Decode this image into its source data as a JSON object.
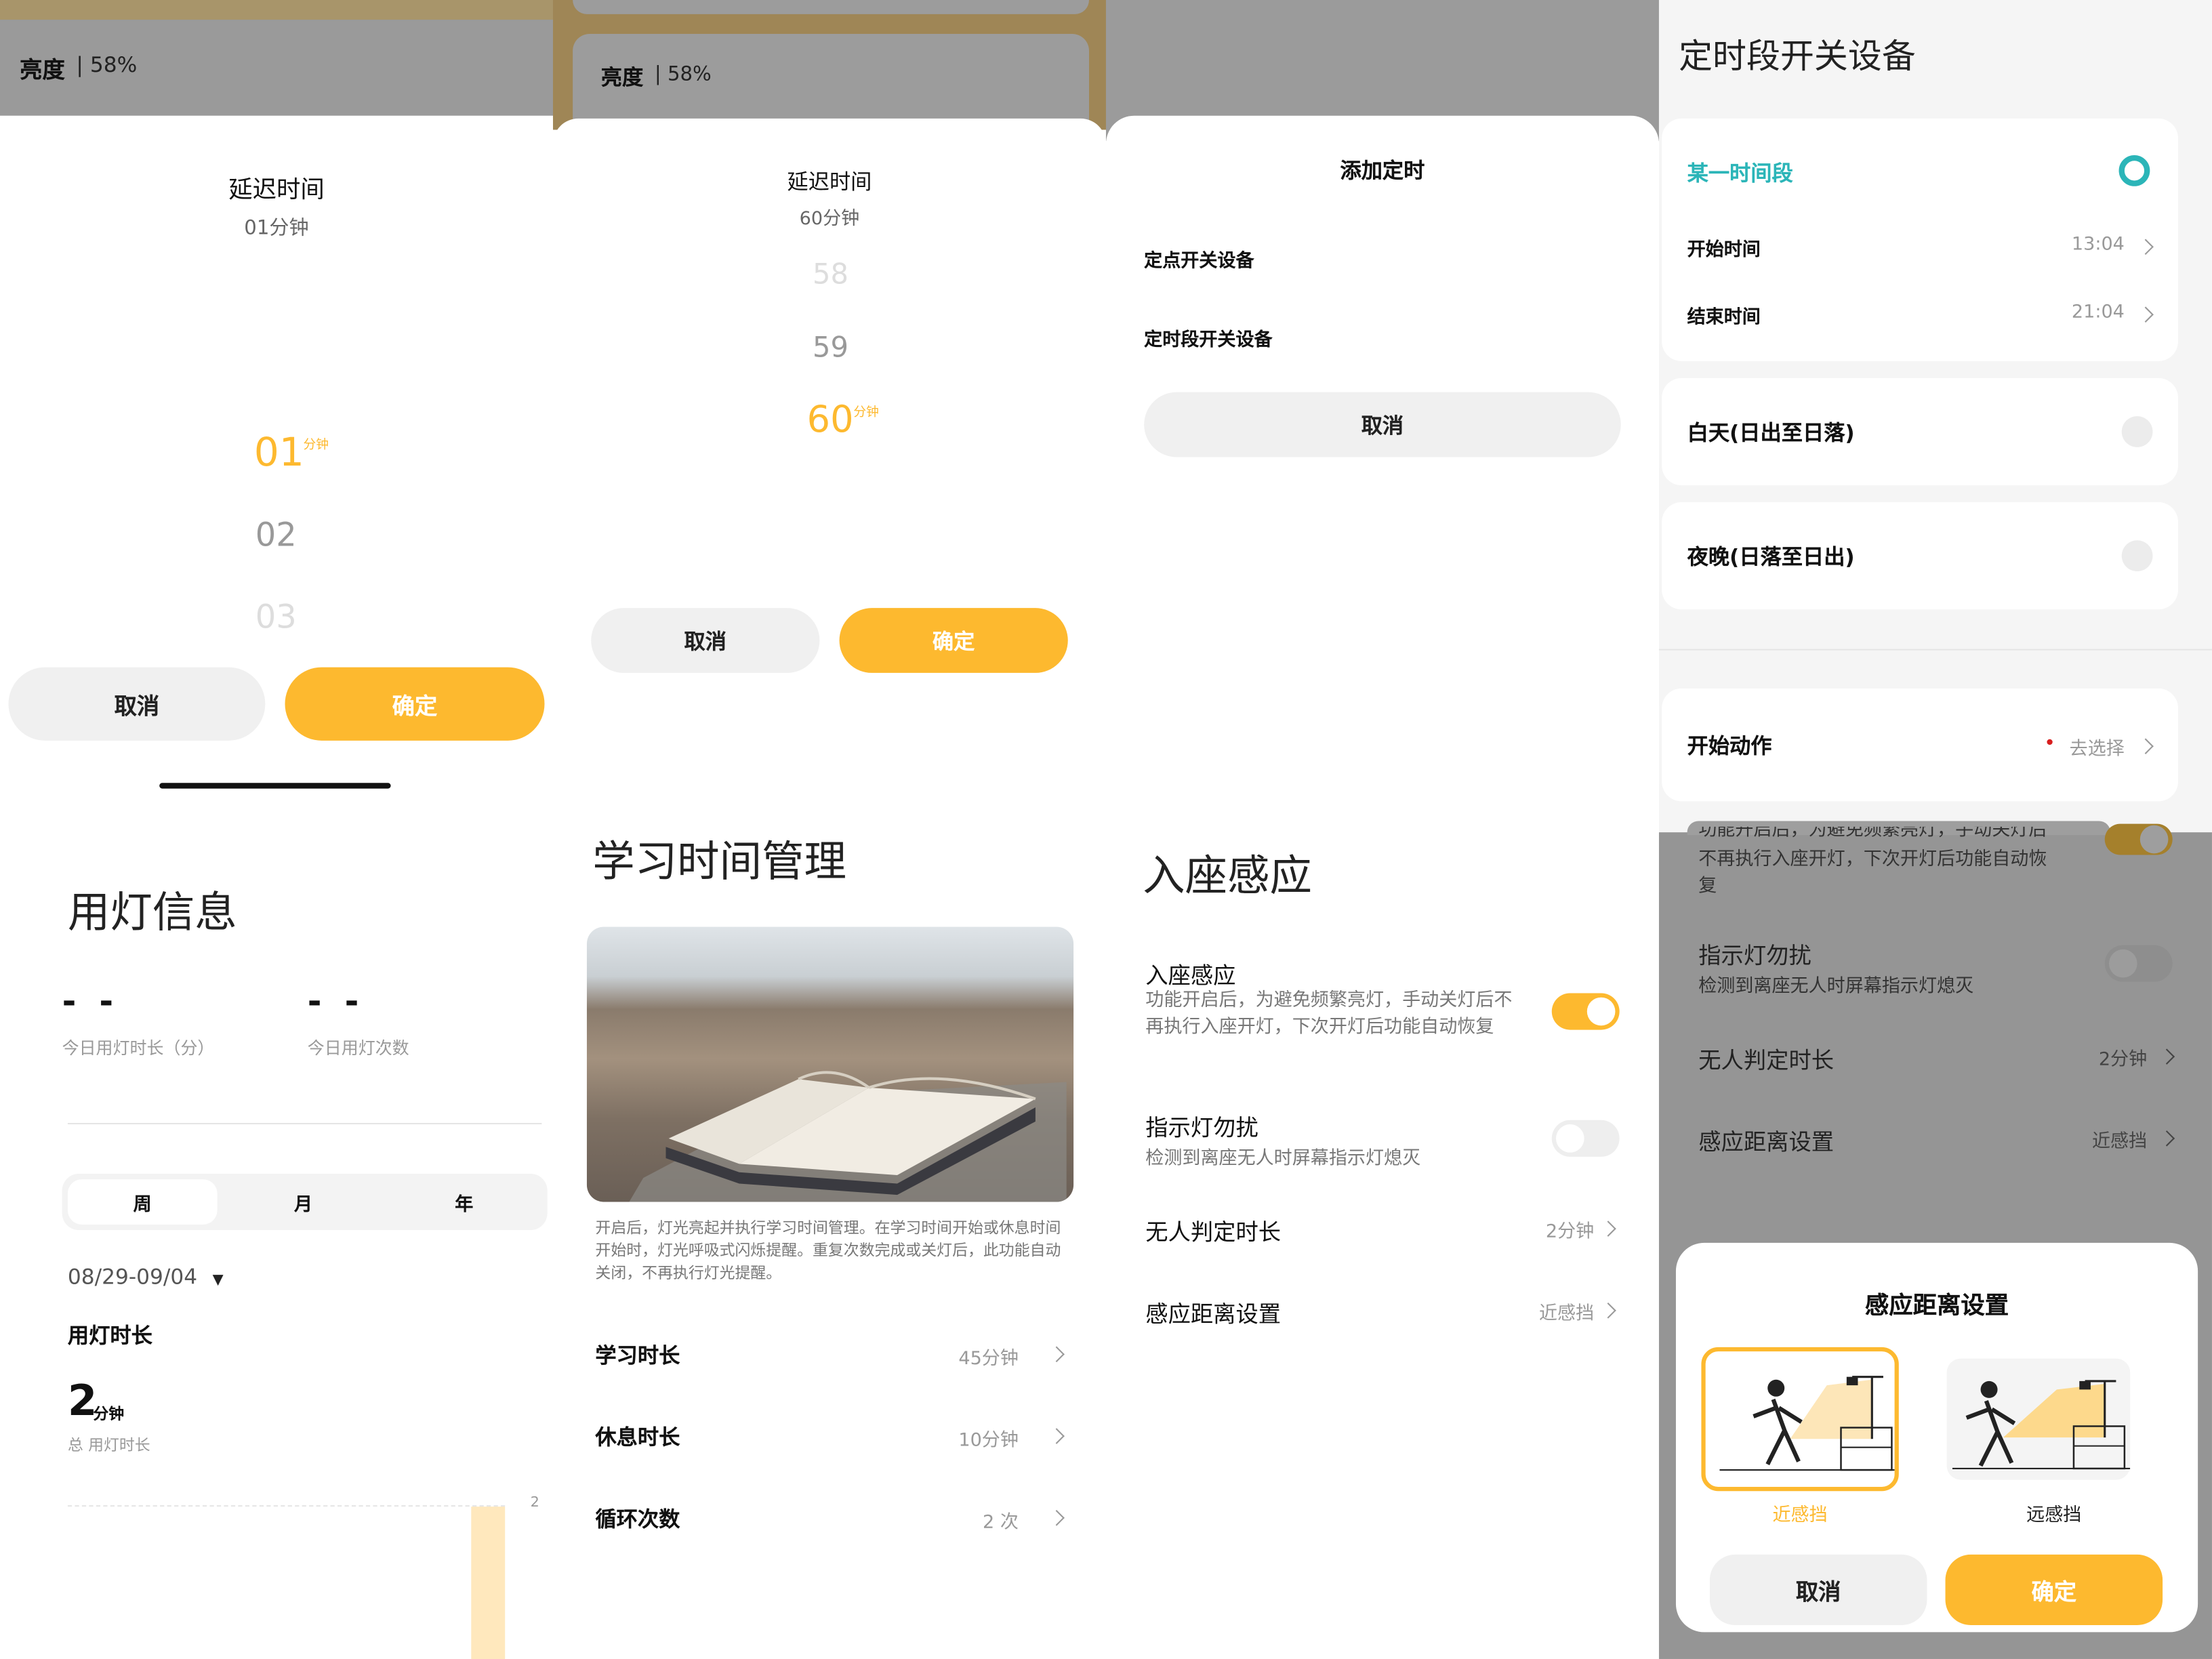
{
  "panel1": {
    "brightness_label": "亮度",
    "brightness_value": "| 58%",
    "delay_title": "延迟时间",
    "delay_value": "01分钟",
    "picker": [
      "01",
      "02",
      "03"
    ],
    "picker_unit": "分钟",
    "cancel": "取消",
    "confirm": "确定",
    "usage_title": "用灯信息",
    "today_duration_value": "- -",
    "today_duration_label": "今日用灯时长（分）",
    "today_count_value": "- -",
    "today_count_label": "今日用灯次数",
    "tabs": [
      "周",
      "月",
      "年"
    ],
    "date_range": "08/29-09/04",
    "duration_heading": "用灯时长",
    "total_value": "2",
    "total_unit": "分钟",
    "total_label": "总 用灯时长",
    "chart_ymax": "2"
  },
  "panel2": {
    "brightness_label": "亮度",
    "brightness_value": "| 58%",
    "delay_title": "延迟时间",
    "delay_value": "60分钟",
    "picker": [
      "58",
      "59",
      "60"
    ],
    "picker_unit": "分钟",
    "cancel": "取消",
    "confirm": "确定",
    "study_title": "学习时间管理",
    "description": "开启后，灯光亮起并执行学习时间管理。在学习时间开始或休息时间开始时，灯光呼吸式闪烁提醒。重复次数完成或关灯后，此功能自动关闭，不再执行灯光提醒。",
    "rows": [
      {
        "label": "学习时长",
        "value": "45分钟"
      },
      {
        "label": "休息时长",
        "value": "10分钟"
      },
      {
        "label": "循环次数",
        "value": "2 次"
      }
    ]
  },
  "panel3": {
    "add_timer_title": "添加定时",
    "option1": "定点开关设备",
    "option2": "定时段开关设备",
    "cancel": "取消",
    "seat_title": "入座感应",
    "seat_label": "入座感应",
    "seat_desc": "功能开启后，为避免频繁亮灯，手动关灯后不再执行入座开灯，下次开灯后功能自动恢复",
    "indicator_label": "指示灯勿扰",
    "indicator_desc": "检测到离座无人时屏幕指示灯熄灭",
    "unmanned_label": "无人判定时长",
    "unmanned_value": "2分钟",
    "distance_label": "感应距离设置",
    "distance_value": "近感挡"
  },
  "panel4": {
    "title": "定时段开关设备",
    "period_label": "某一时间段",
    "start_label": "开始时间",
    "start_value": "13:04",
    "end_label": "结束时间",
    "end_value": "21:04",
    "day_label": "白天(日出至日落)",
    "night_label": "夜晚(日落至日出)",
    "action_label": "开始动作",
    "action_value": "去选择",
    "seat_desc_partial_1": "功能开启后，为避免频繁亮灯，手动关灯后",
    "seat_desc_partial_2": "不再执行入座开灯，下次开灯后功能自动恢",
    "seat_desc_partial_3": "复",
    "indicator_label": "指示灯勿扰",
    "indicator_desc": "检测到离座无人时屏幕指示灯熄灭",
    "unmanned_label": "无人判定时长",
    "unmanned_value": "2分钟",
    "distance_label": "感应距离设置",
    "distance_value": "近感挡",
    "sheet_title": "感应距离设置",
    "near_label": "近感挡",
    "far_label": "远感挡",
    "cancel": "取消",
    "confirm": "确定"
  },
  "colors": {
    "accent": "#fdb92f",
    "teal": "#2bb5b8",
    "dim": "#979797"
  }
}
